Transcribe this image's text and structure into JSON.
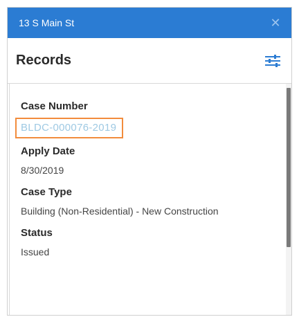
{
  "window": {
    "title": "13 S Main St",
    "close_icon": "close-icon",
    "titlebar_color": "#2b7cd3"
  },
  "section": {
    "heading": "Records",
    "filter_icon": "sliders-icon"
  },
  "record": {
    "case_number": {
      "label": "Case Number",
      "value": "BLDC-000076-2019",
      "link_color": "#9ec9e3",
      "highlight_color": "#f28c3c"
    },
    "apply_date": {
      "label": "Apply Date",
      "value": "8/30/2019"
    },
    "case_type": {
      "label": "Case Type",
      "value": "Building (Non-Residential) - New Construction"
    },
    "status": {
      "label": "Status",
      "value": "Issued"
    }
  }
}
